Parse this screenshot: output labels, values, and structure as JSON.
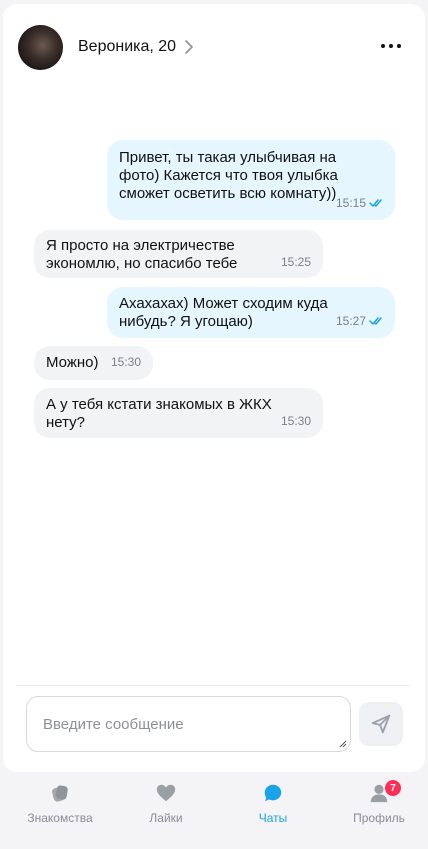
{
  "chat": {
    "contact_name": "Вероника, 20"
  },
  "messages": [
    {
      "direction": "out",
      "text": "Привет, ты такая улыбчивая на фото) Кажется что твоя улыбка сможет осветить всю комнату))",
      "time": "15:15",
      "read": true
    },
    {
      "direction": "in",
      "text": "Я просто на электричестве экономлю, но спасибо тебе",
      "time": "15:25"
    },
    {
      "direction": "out",
      "text": "Ахахахах) Может сходим куда нибудь? Я угощаю)",
      "time": "15:27",
      "read": true
    },
    {
      "direction": "in",
      "text": "Можно)",
      "time": "15:30"
    },
    {
      "direction": "in",
      "text": "А у тебя кстати знакомых в ЖКХ нету?",
      "time": "15:30"
    }
  ],
  "composer": {
    "placeholder": "Введите сообщение"
  },
  "tabs": [
    {
      "label": "Знакомства",
      "icon": "cards-icon",
      "active": false
    },
    {
      "label": "Лайки",
      "icon": "heart-icon",
      "active": false
    },
    {
      "label": "Чаты",
      "icon": "chat-bubble-icon",
      "active": true
    },
    {
      "label": "Профиль",
      "icon": "user-icon",
      "active": false,
      "badge": "7"
    }
  ],
  "colors": {
    "accent": "#1aa3e8",
    "outgoing_bubble": "#e6f6fe",
    "incoming_bubble": "#f2f3f5",
    "badge": "#ff2d55",
    "read_ticks": "#1aa3e8"
  }
}
